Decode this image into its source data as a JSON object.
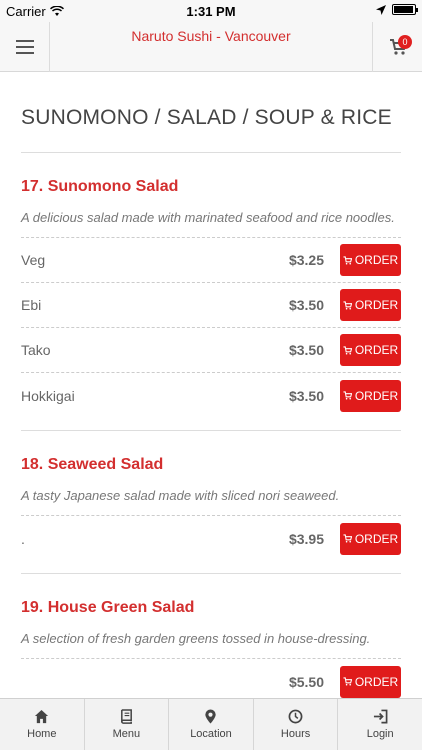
{
  "status_bar": {
    "carrier": "Carrier",
    "time": "1:31 PM"
  },
  "header": {
    "title": "Naruto Sushi - Vancouver",
    "cart_count": "0"
  },
  "section": {
    "title": "SUNOMONO / SALAD / SOUP & RICE"
  },
  "items": [
    {
      "name": "17. Sunomono Salad",
      "description": "A delicious salad made with marinated seafood and rice noodles.",
      "options": [
        {
          "name": "Veg",
          "price": "$3.25",
          "button": "ORDER"
        },
        {
          "name": "Ebi",
          "price": "$3.50",
          "button": "ORDER"
        },
        {
          "name": "Tako",
          "price": "$3.50",
          "button": "ORDER"
        },
        {
          "name": "Hokkigai",
          "price": "$3.50",
          "button": "ORDER"
        }
      ]
    },
    {
      "name": "18. Seaweed Salad",
      "description": "A tasty Japanese salad made with sliced nori seaweed.",
      "options": [
        {
          "name": ".",
          "price": "$3.95",
          "button": "ORDER"
        }
      ]
    },
    {
      "name": "19. House Green Salad",
      "description": "A selection of fresh garden greens tossed in house-dressing.",
      "options": [
        {
          "name": "",
          "price": "$5.50",
          "button": "ORDER"
        }
      ]
    }
  ],
  "tabs": [
    {
      "label": "Home",
      "icon": "home-icon"
    },
    {
      "label": "Menu",
      "icon": "book-icon"
    },
    {
      "label": "Location",
      "icon": "map-pin-icon"
    },
    {
      "label": "Hours",
      "icon": "clock-icon"
    },
    {
      "label": "Login",
      "icon": "login-icon"
    }
  ],
  "colors": {
    "accent": "#d32f2f",
    "button": "#e01b1b"
  }
}
